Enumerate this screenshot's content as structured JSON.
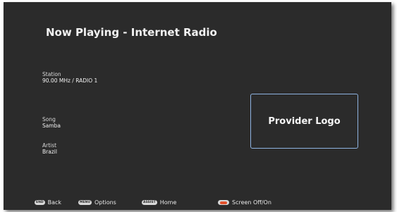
{
  "header": {
    "title": "Now Playing - Internet Radio"
  },
  "station": {
    "label": "Station",
    "value": "90.00 MHz / RADIO 1"
  },
  "song": {
    "label": "Song",
    "value": "Samba"
  },
  "artist": {
    "label": "Artist",
    "value": "Brazil"
  },
  "provider_logo": {
    "text": "Provider Logo"
  },
  "footer": {
    "back": {
      "key": "END",
      "label": "Back"
    },
    "options": {
      "key": "MENU",
      "label": "Options"
    },
    "home": {
      "key": "ASSIST",
      "label": "Home"
    },
    "screen": {
      "key_color": "#e2512b",
      "label": "Screen Off/On"
    }
  },
  "colors": {
    "background": "#2b2b2b",
    "logo_border": "#8fb4e2",
    "red_button": "#e2512b"
  }
}
